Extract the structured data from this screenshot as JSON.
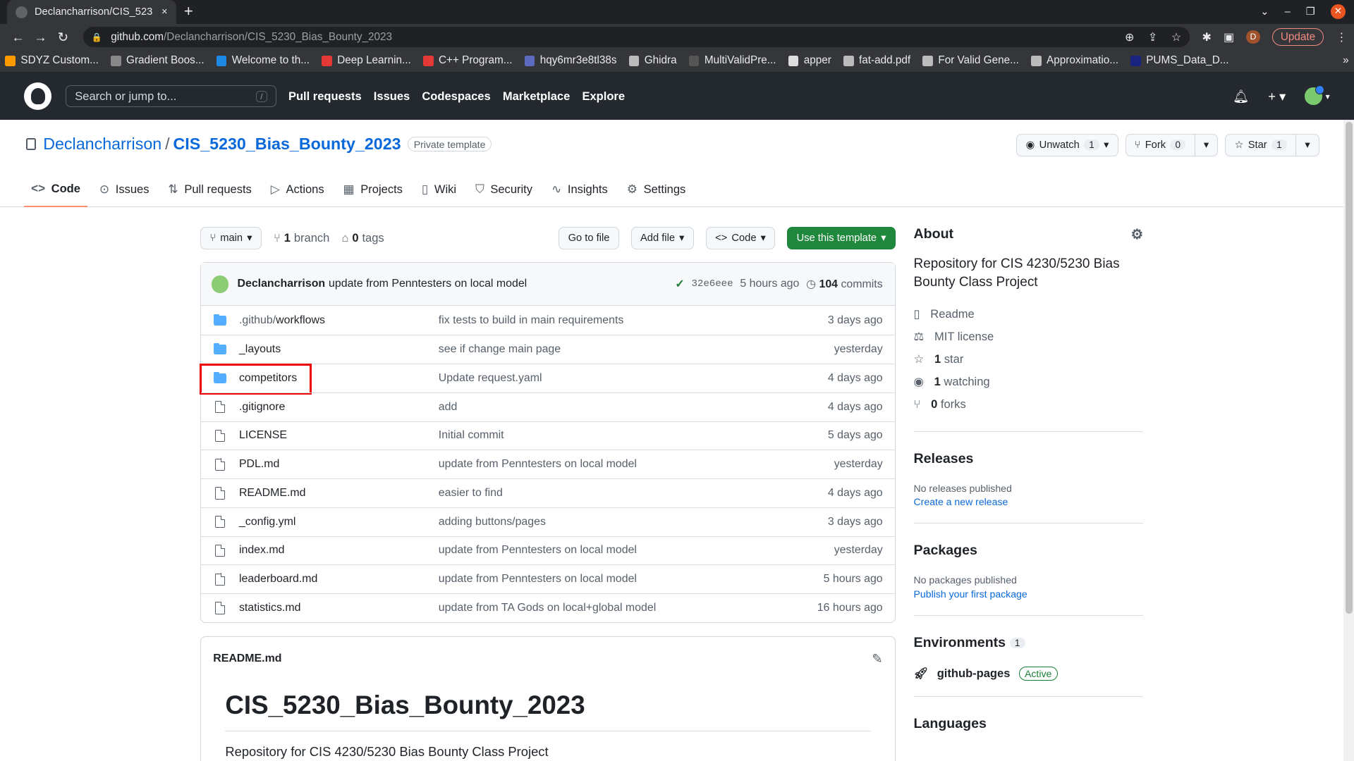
{
  "browser": {
    "tab_title": "Declancharrison/CIS_523",
    "tab_close": "×",
    "new_tab": "+",
    "url_host": "github.com",
    "url_path": "/Declancharrison/CIS_5230_Bias_Bounty_2023",
    "update_label": "Update",
    "profile_initial": "D",
    "bookmarks": [
      "SDYZ Custom...",
      "Gradient Boos...",
      "Welcome to th...",
      "Deep Learnin...",
      "C++ Program...",
      "hqy6mr3e8tl38s",
      "Ghidra",
      "MultiValidPre...",
      "apper",
      "fat-add.pdf",
      "For Valid Gene...",
      "Approximatio...",
      "PUMS_Data_D..."
    ],
    "bookmark_colors": [
      "#ff9900",
      "#888888",
      "#1e88e5",
      "#e53935",
      "#e53935",
      "#5c6bc0",
      "#bbbbbb",
      "#555555",
      "#dddddd",
      "#bbbbbb",
      "#bbbbbb",
      "#bbbbbb",
      "#1a237e"
    ]
  },
  "gh": {
    "search_placeholder": "Search or jump to...",
    "search_key": "/",
    "nav": [
      "Pull requests",
      "Issues",
      "Codespaces",
      "Marketplace",
      "Explore"
    ]
  },
  "repo": {
    "owner": "Declancharrison",
    "name": "CIS_5230_Bias_Bounty_2023",
    "visibility": "Private template",
    "unwatch_label": "Unwatch",
    "watch_count": "1",
    "fork_label": "Fork",
    "fork_count": "0",
    "star_label": "Star",
    "star_count": "1",
    "tabs": [
      "Code",
      "Issues",
      "Pull requests",
      "Actions",
      "Projects",
      "Wiki",
      "Security",
      "Insights",
      "Settings"
    ]
  },
  "filenav": {
    "branch": "main",
    "branch_count": "1",
    "branch_label": "branch",
    "tag_count": "0",
    "tag_label": "tags",
    "goto_file": "Go to file",
    "add_file": "Add file",
    "code": "Code",
    "use_template": "Use this template"
  },
  "commit": {
    "author": "Declancharrison",
    "message": "update from Penntesters on local model",
    "sha": "32e6eee",
    "time": "5 hours ago",
    "count": "104",
    "count_label": "commits"
  },
  "files": [
    {
      "type": "dir",
      "name_prefix": ".github/",
      "name": "workflows",
      "message": "fix tests to build in main requirements",
      "age": "3 days ago"
    },
    {
      "type": "dir",
      "name_prefix": "",
      "name": "_layouts",
      "message": "see if change main page",
      "age": "yesterday"
    },
    {
      "type": "dir",
      "name_prefix": "",
      "name": "competitors",
      "message": "Update request.yaml",
      "age": "4 days ago"
    },
    {
      "type": "file",
      "name_prefix": "",
      "name": ".gitignore",
      "message": "add",
      "age": "4 days ago"
    },
    {
      "type": "file",
      "name_prefix": "",
      "name": "LICENSE",
      "message": "Initial commit",
      "age": "5 days ago"
    },
    {
      "type": "file",
      "name_prefix": "",
      "name": "PDL.md",
      "message": "update from Penntesters on local model",
      "age": "yesterday"
    },
    {
      "type": "file",
      "name_prefix": "",
      "name": "README.md",
      "message": "easier to find",
      "age": "4 days ago"
    },
    {
      "type": "file",
      "name_prefix": "",
      "name": "_config.yml",
      "message": "adding buttons/pages",
      "age": "3 days ago"
    },
    {
      "type": "file",
      "name_prefix": "",
      "name": "index.md",
      "message": "update from Penntesters on local model",
      "age": "yesterday"
    },
    {
      "type": "file",
      "name_prefix": "",
      "name": "leaderboard.md",
      "message": "update from Penntesters on local model",
      "age": "5 hours ago"
    },
    {
      "type": "file",
      "name_prefix": "",
      "name": "statistics.md",
      "message": "update from TA Gods on local+global model",
      "age": "16 hours ago"
    }
  ],
  "readme": {
    "filename": "README.md",
    "heading": "CIS_5230_Bias_Bounty_2023",
    "text": "Repository for CIS 4230/5230 Bias Bounty Class Project"
  },
  "about": {
    "title": "About",
    "description": "Repository for CIS 4230/5230 Bias Bounty Class Project",
    "readme": "Readme",
    "license": "MIT license",
    "stars_count": "1",
    "stars_label": "star",
    "watching_count": "1",
    "watching_label": "watching",
    "forks_count": "0",
    "forks_label": "forks"
  },
  "releases": {
    "title": "Releases",
    "empty": "No releases published",
    "link": "Create a new release"
  },
  "packages": {
    "title": "Packages",
    "empty": "No packages published",
    "link": "Publish your first package"
  },
  "environments": {
    "title": "Environments",
    "count": "1",
    "name": "github-pages",
    "status": "Active"
  },
  "languages": {
    "title": "Languages"
  }
}
